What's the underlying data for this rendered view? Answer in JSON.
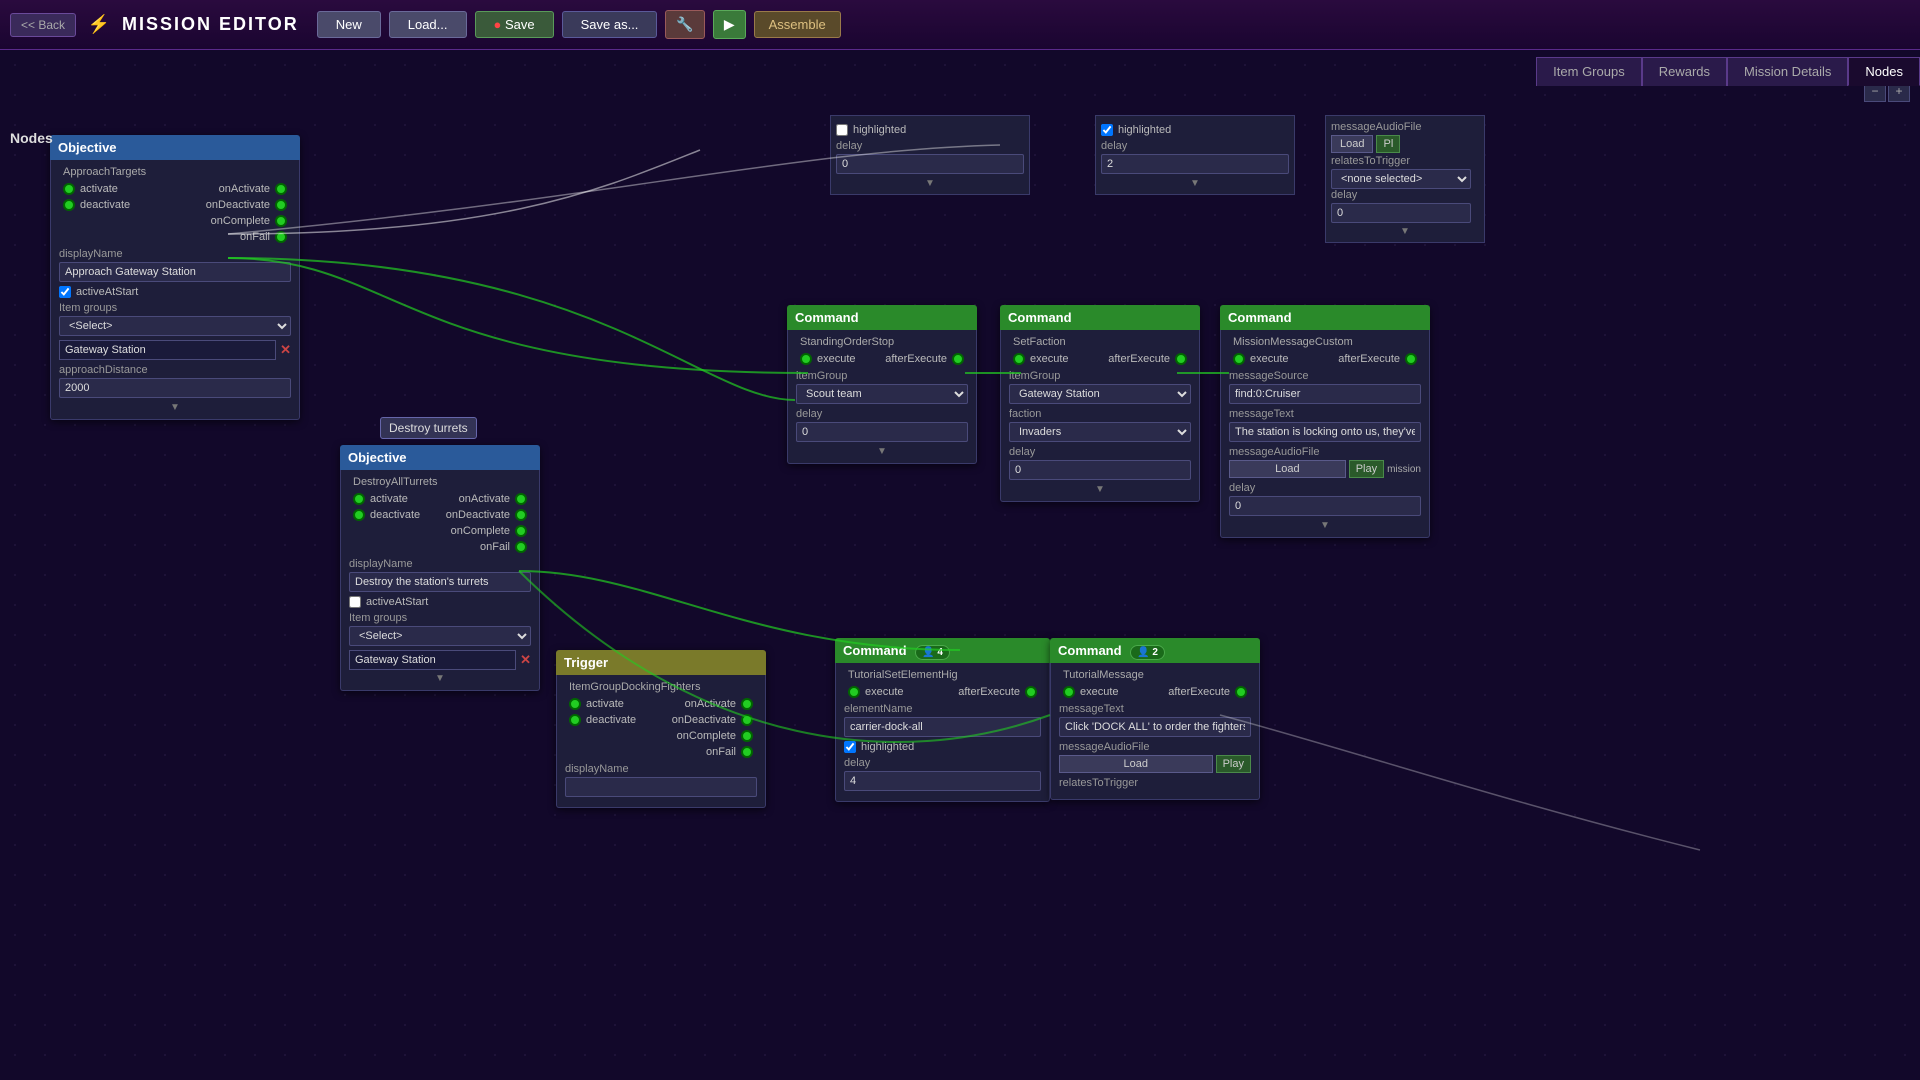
{
  "header": {
    "back_label": "<< Back",
    "logo": "⚡",
    "title": "MISSION EDITOR",
    "new_label": "New",
    "load_label": "Load...",
    "save_label": "Save",
    "save_as_label": "Save as...",
    "wrench_icon": "🔧",
    "play_icon": "▶",
    "assemble_label": "Assemble"
  },
  "tabs": [
    {
      "id": "item-groups",
      "label": "Item Groups"
    },
    {
      "id": "rewards",
      "label": "Rewards"
    },
    {
      "id": "mission-details",
      "label": "Mission Details"
    },
    {
      "id": "nodes",
      "label": "Nodes",
      "active": true
    }
  ],
  "nodes_section_label": "Nodes",
  "nodes": {
    "objective1": {
      "title": "Objective",
      "subtitle": "ApproachTargets",
      "ports_left": [
        "activate",
        "deactivate"
      ],
      "ports_right": [
        "onActivate",
        "onDeactivate",
        "onComplete",
        "onFail"
      ],
      "display_name_label": "displayName",
      "display_name_value": "Approach Gateway Station",
      "active_at_start_label": "activeAtStart",
      "active_at_start_checked": true,
      "item_groups_label": "Item groups",
      "item_groups_select": "<Select>",
      "item_group_tag": "Gateway Station",
      "approach_distance_label": "approachDistance",
      "approach_distance_value": "2000"
    },
    "objective2": {
      "title": "Objective",
      "subtitle": "DestroyAllTurrets",
      "tooltip": "Destroy turrets",
      "ports_left": [
        "activate",
        "deactivate"
      ],
      "ports_right": [
        "onActivate",
        "onDeactivate",
        "onComplete",
        "onFail"
      ],
      "display_name_label": "displayName",
      "display_name_value": "Destroy the station's turrets",
      "active_at_start_label": "activeAtStart",
      "active_at_start_checked": false,
      "item_groups_label": "Item groups",
      "item_groups_select": "<Select>",
      "item_group_tag": "Gateway Station"
    },
    "command1": {
      "title": "Command",
      "subtitle": "StandingOrderStop",
      "ports": [
        "execute",
        "afterExecute"
      ],
      "item_group_label": "itemGroup",
      "item_group_value": "Scout team",
      "delay_label": "delay",
      "delay_value": "0"
    },
    "command2": {
      "title": "Command",
      "subtitle": "SetFaction",
      "ports": [
        "execute",
        "afterExecute"
      ],
      "item_group_label": "itemGroup",
      "item_group_value": "Gateway Station",
      "faction_label": "faction",
      "faction_value": "Invaders",
      "delay_label": "delay",
      "delay_value": "0"
    },
    "command3": {
      "title": "Command",
      "subtitle": "MissionMessageCustom",
      "ports": [
        "execute",
        "afterExecute"
      ],
      "message_source_label": "messageSource",
      "message_source_value": "find:0:Cruiser",
      "message_text_label": "messageText",
      "message_text_value": "The station is locking onto us, they've g",
      "audio_file_label": "messageAudioFile",
      "load_label": "Load",
      "play_label": "Play",
      "relates_to_trigger_label": "relatesToTrigger",
      "relates_to_trigger_value": "<none selected>",
      "delay_label": "delay",
      "delay_value": "0"
    },
    "trigger1": {
      "title": "Trigger",
      "subtitle": "ItemGroupDockingFighters",
      "ports_left": [
        "activate",
        "deactivate"
      ],
      "ports_right": [
        "onActivate",
        "onDeactivate",
        "onComplete",
        "onFail"
      ],
      "display_name_label": "displayName",
      "display_name_value": ""
    },
    "command4": {
      "title": "Command",
      "subtitle": "TutorialSetElementHig",
      "badge": "4",
      "ports": [
        "execute",
        "afterExecute"
      ],
      "element_name_label": "elementName",
      "element_name_value": "carrier-dock-all",
      "highlighted_label": "highlighted",
      "highlighted_checked": true,
      "delay_label": "delay",
      "delay_value": "4"
    },
    "command5": {
      "title": "Command",
      "subtitle": "TutorialMessage",
      "badge": "2",
      "ports": [
        "execute",
        "afterExecute"
      ],
      "message_text_label": "messageText",
      "message_text_value": "Click 'DOCK ALL' to order the fighters t",
      "audio_file_label": "messageAudioFile",
      "load_label": "Load",
      "play_label": "Play",
      "relates_to_trigger_label": "relatesToTrigger"
    }
  },
  "partial_top": {
    "highlighted_label": "highlighted",
    "delay_label": "delay",
    "delay_value": "0"
  },
  "partial_top2": {
    "highlighted_label": "highlighted",
    "delay_label": "delay",
    "delay_value": "2"
  },
  "partial_top3": {
    "audio_label": "messageAudioFile",
    "load_label": "Load",
    "play_label": "Pl",
    "relates_label": "relatesToTrigger",
    "relates_value": "<none selected>",
    "delay_label": "delay",
    "delay_value": "0"
  },
  "canvas_controls": {
    "minus_label": "−",
    "plus_label": "+"
  }
}
